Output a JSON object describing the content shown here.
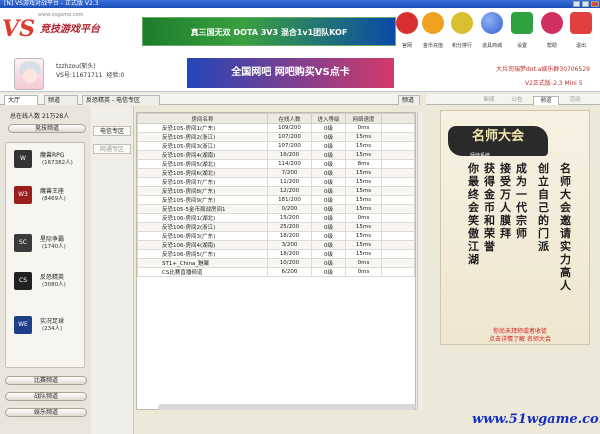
{
  "title": "[N] VS游戏对战平台 - 正式版 V2.3",
  "header": {
    "logo_vs": "VS",
    "logo_name": "竞技游戏平台",
    "logo_sub": "www.vsgame.com",
    "banner1": "真三国无双  DOTA 3V3  混合1v1团队KOF",
    "banner2": "全国网吧 网吧购买VS点卡"
  },
  "top_icons": [
    {
      "label": "官网",
      "color": "#d83030",
      "icon": "heart-icon"
    },
    {
      "label": "金币充值",
      "color": "#f0a020",
      "icon": "coin-icon"
    },
    {
      "label": "积分排行",
      "color": "#d8c030",
      "icon": "trophy-icon"
    },
    {
      "label": "道具商城",
      "color": "#3060d0",
      "icon": "globe-icon"
    },
    {
      "label": "设置",
      "color": "#30a040",
      "icon": "gear-icon"
    },
    {
      "label": "帮助",
      "color": "#d03060",
      "icon": "help-icon"
    },
    {
      "label": "退出",
      "color": "#e04040",
      "icon": "exit-icon"
    }
  ],
  "user": {
    "name": "tzzhzou(斩头)",
    "id_label": "VS号:",
    "id_value": "11671711",
    "exp_label": "经验:",
    "exp_value": "0",
    "ad_text": "大兵司瑞梦dot.a娱乐群30706529",
    "version": "V2正式版-2.3 Mini 5"
  },
  "tabs": {
    "hall": "大厅",
    "channel": "频道",
    "breadcrumb": "反恐精英 - 电信专区",
    "right_btn": "频道"
  },
  "left": {
    "online_label": "总在线人数",
    "online_value": "21万28人",
    "top_button": "竞技频道",
    "games": [
      {
        "name": "魔兽RPG",
        "count": "(167382人)",
        "icon": "warcraft-icon"
      },
      {
        "name": "魔兽王座",
        "count": "(8469人)",
        "icon": "wc3-icon"
      },
      {
        "name": "星际争霸",
        "count": "(1740人)",
        "icon": "starcraft-icon"
      },
      {
        "name": "反恐精英",
        "count": "(3080人)",
        "icon": "cs-icon"
      },
      {
        "name": "实况足球",
        "count": "(234人)",
        "icon": "soccer-icon"
      }
    ],
    "bottom_buttons": [
      "比赛频道",
      "战队频道",
      "娱乐频道"
    ]
  },
  "subnav": [
    "电信专区",
    "网通专区"
  ],
  "table": {
    "headers": [
      "房间名称",
      "在线人数",
      "进入等级",
      "网络速度"
    ],
    "rows": [
      [
        "反恐105-房间1(广东)",
        "109/200",
        "0级",
        "0ms"
      ],
      [
        "反恐105-房间2(浙江)",
        "107/200",
        "0级",
        "15ms"
      ],
      [
        "反恐105-房间3(浙江)",
        "107/200",
        "0级",
        "15ms"
      ],
      [
        "反恐105-房间4(湖南)",
        "16/200",
        "0级",
        "15ms"
      ],
      [
        "反恐105-房间5(湖北)",
        "114/200",
        "0级",
        "8ms"
      ],
      [
        "反恐105-房间6(湖北)",
        "7/200",
        "0级",
        "15ms"
      ],
      [
        "反恐105-房间7(广东)",
        "11/200",
        "0级",
        "15ms"
      ],
      [
        "反恐105-房间8(广东)",
        "12/200",
        "0级",
        "15ms"
      ],
      [
        "反恐105-房间9(广东)",
        "181/200",
        "0级",
        "15ms"
      ],
      [
        "反恐105-5金币局战房间1",
        "0/200",
        "0级",
        "15ms"
      ],
      [
        "反恐106-房间1(湖北)",
        "15/200",
        "0级",
        "0ms"
      ],
      [
        "反恐106-房间2(浙江)",
        "25/200",
        "0级",
        "15ms"
      ],
      [
        "反恐106-房间3(广东)",
        "18/200",
        "0级",
        "15ms"
      ],
      [
        "反恐106-房间4(湖南)",
        "3/200",
        "0级",
        "15ms"
      ],
      [
        "反恐106-房间5(广东)",
        "18/200",
        "0级",
        "15ms"
      ],
      [
        "ST1+_China_魅聚",
        "10/200",
        "0级",
        "0ms"
      ],
      [
        "CS比赛直播频道",
        "6/200",
        "0级",
        "0ms"
      ]
    ]
  },
  "right": {
    "tabs": [
      "新闻",
      "公告",
      "频道",
      "活动"
    ],
    "poster_title": "名师大会",
    "poster_sub": "师徒系统",
    "poster_cols": [
      "名师大会邀请实力高人",
      "创立自己的门派",
      "成为一代宗师",
      "接受万人膜拜",
      "获得金币和荣誉",
      "你最终会笑傲江湖"
    ],
    "link1": "你尚未拜师或者收徒",
    "link2": "点击详情了解 名师大会"
  },
  "watermark": "www.51wgame.com"
}
